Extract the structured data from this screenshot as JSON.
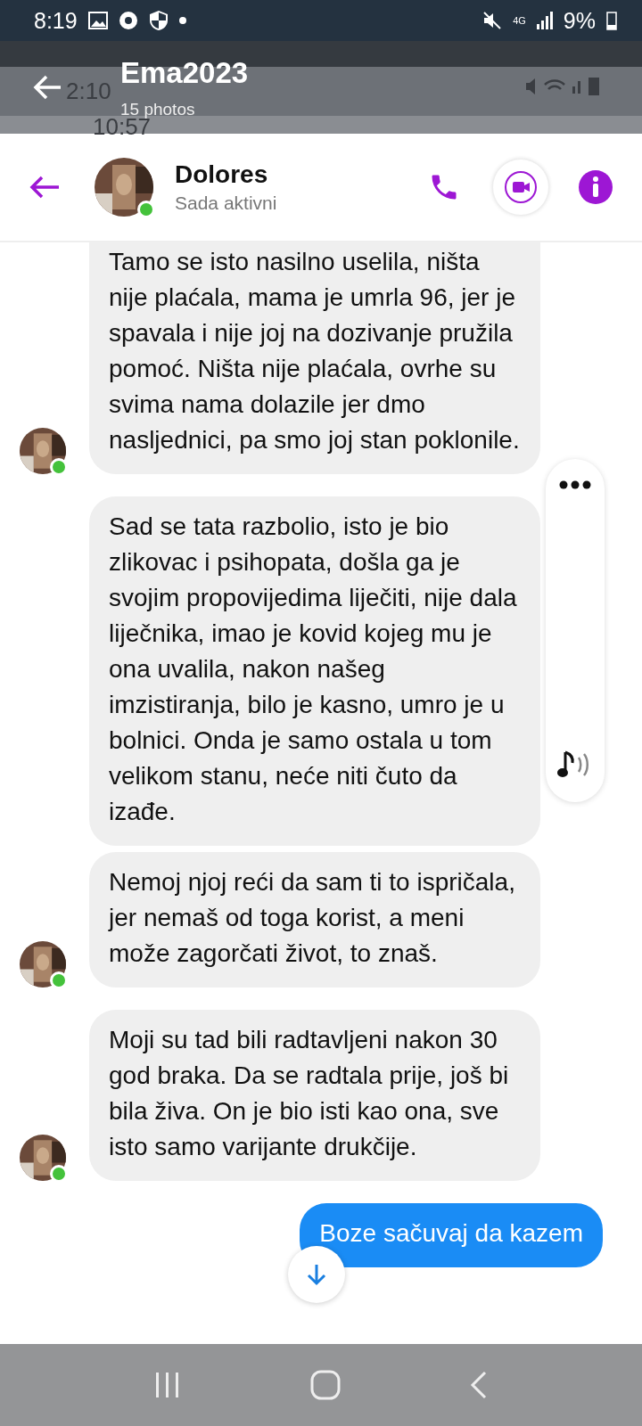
{
  "status_bar": {
    "time": "8:19",
    "network": "4G",
    "battery": "9%"
  },
  "gallery_bar": {
    "title": "Ema2023",
    "subtitle": "15 photos",
    "ghost_times": [
      "2:10",
      "10:57"
    ]
  },
  "chat_header": {
    "name": "Dolores",
    "status": "Sada aktivni",
    "online": true
  },
  "messages": [
    {
      "kind": "received",
      "avatar": true,
      "cut_top": true,
      "text": "Tamo se isto nasilno uselila, ništa nije plaćala, mama je umrla 96, jer je spavala i nije joj na dozivanje pružila pomoć. Ništa nije plaćala, ovrhe su svima nama dolazile jer dmo nasljednici, pa smo joj stan poklonile."
    },
    {
      "kind": "received",
      "avatar": false,
      "cut_top": false,
      "text": "Sad se tata razbolio, isto je bio zlikovac i psihopata, došla ga je svojim propovijedima liječiti, nije dala liječnika, imao je kovid kojeg mu je ona uvalila, nakon našeg imzistiranja, bilo je kasno, umro je u bolnici. Onda je samo ostala u tom velikom stanu, neće niti čuto da izađe."
    },
    {
      "kind": "received",
      "avatar": true,
      "cut_top": false,
      "text": "Nemoj njoj reći da sam ti to ispričala, jer nemaš od toga korist, a meni može zagorčati život, to znaš."
    },
    {
      "kind": "received",
      "avatar": true,
      "cut_top": false,
      "text": "Moji su tad bili radtavljeni nakon 30 god braka. Da se radtala prije, još bi bila živa. On je bio isti kao ona, sve isto samo varijante drukčije."
    },
    {
      "kind": "sent",
      "avatar": false,
      "cut_top": false,
      "text": "Boze sačuvaj da kazem"
    }
  ]
}
